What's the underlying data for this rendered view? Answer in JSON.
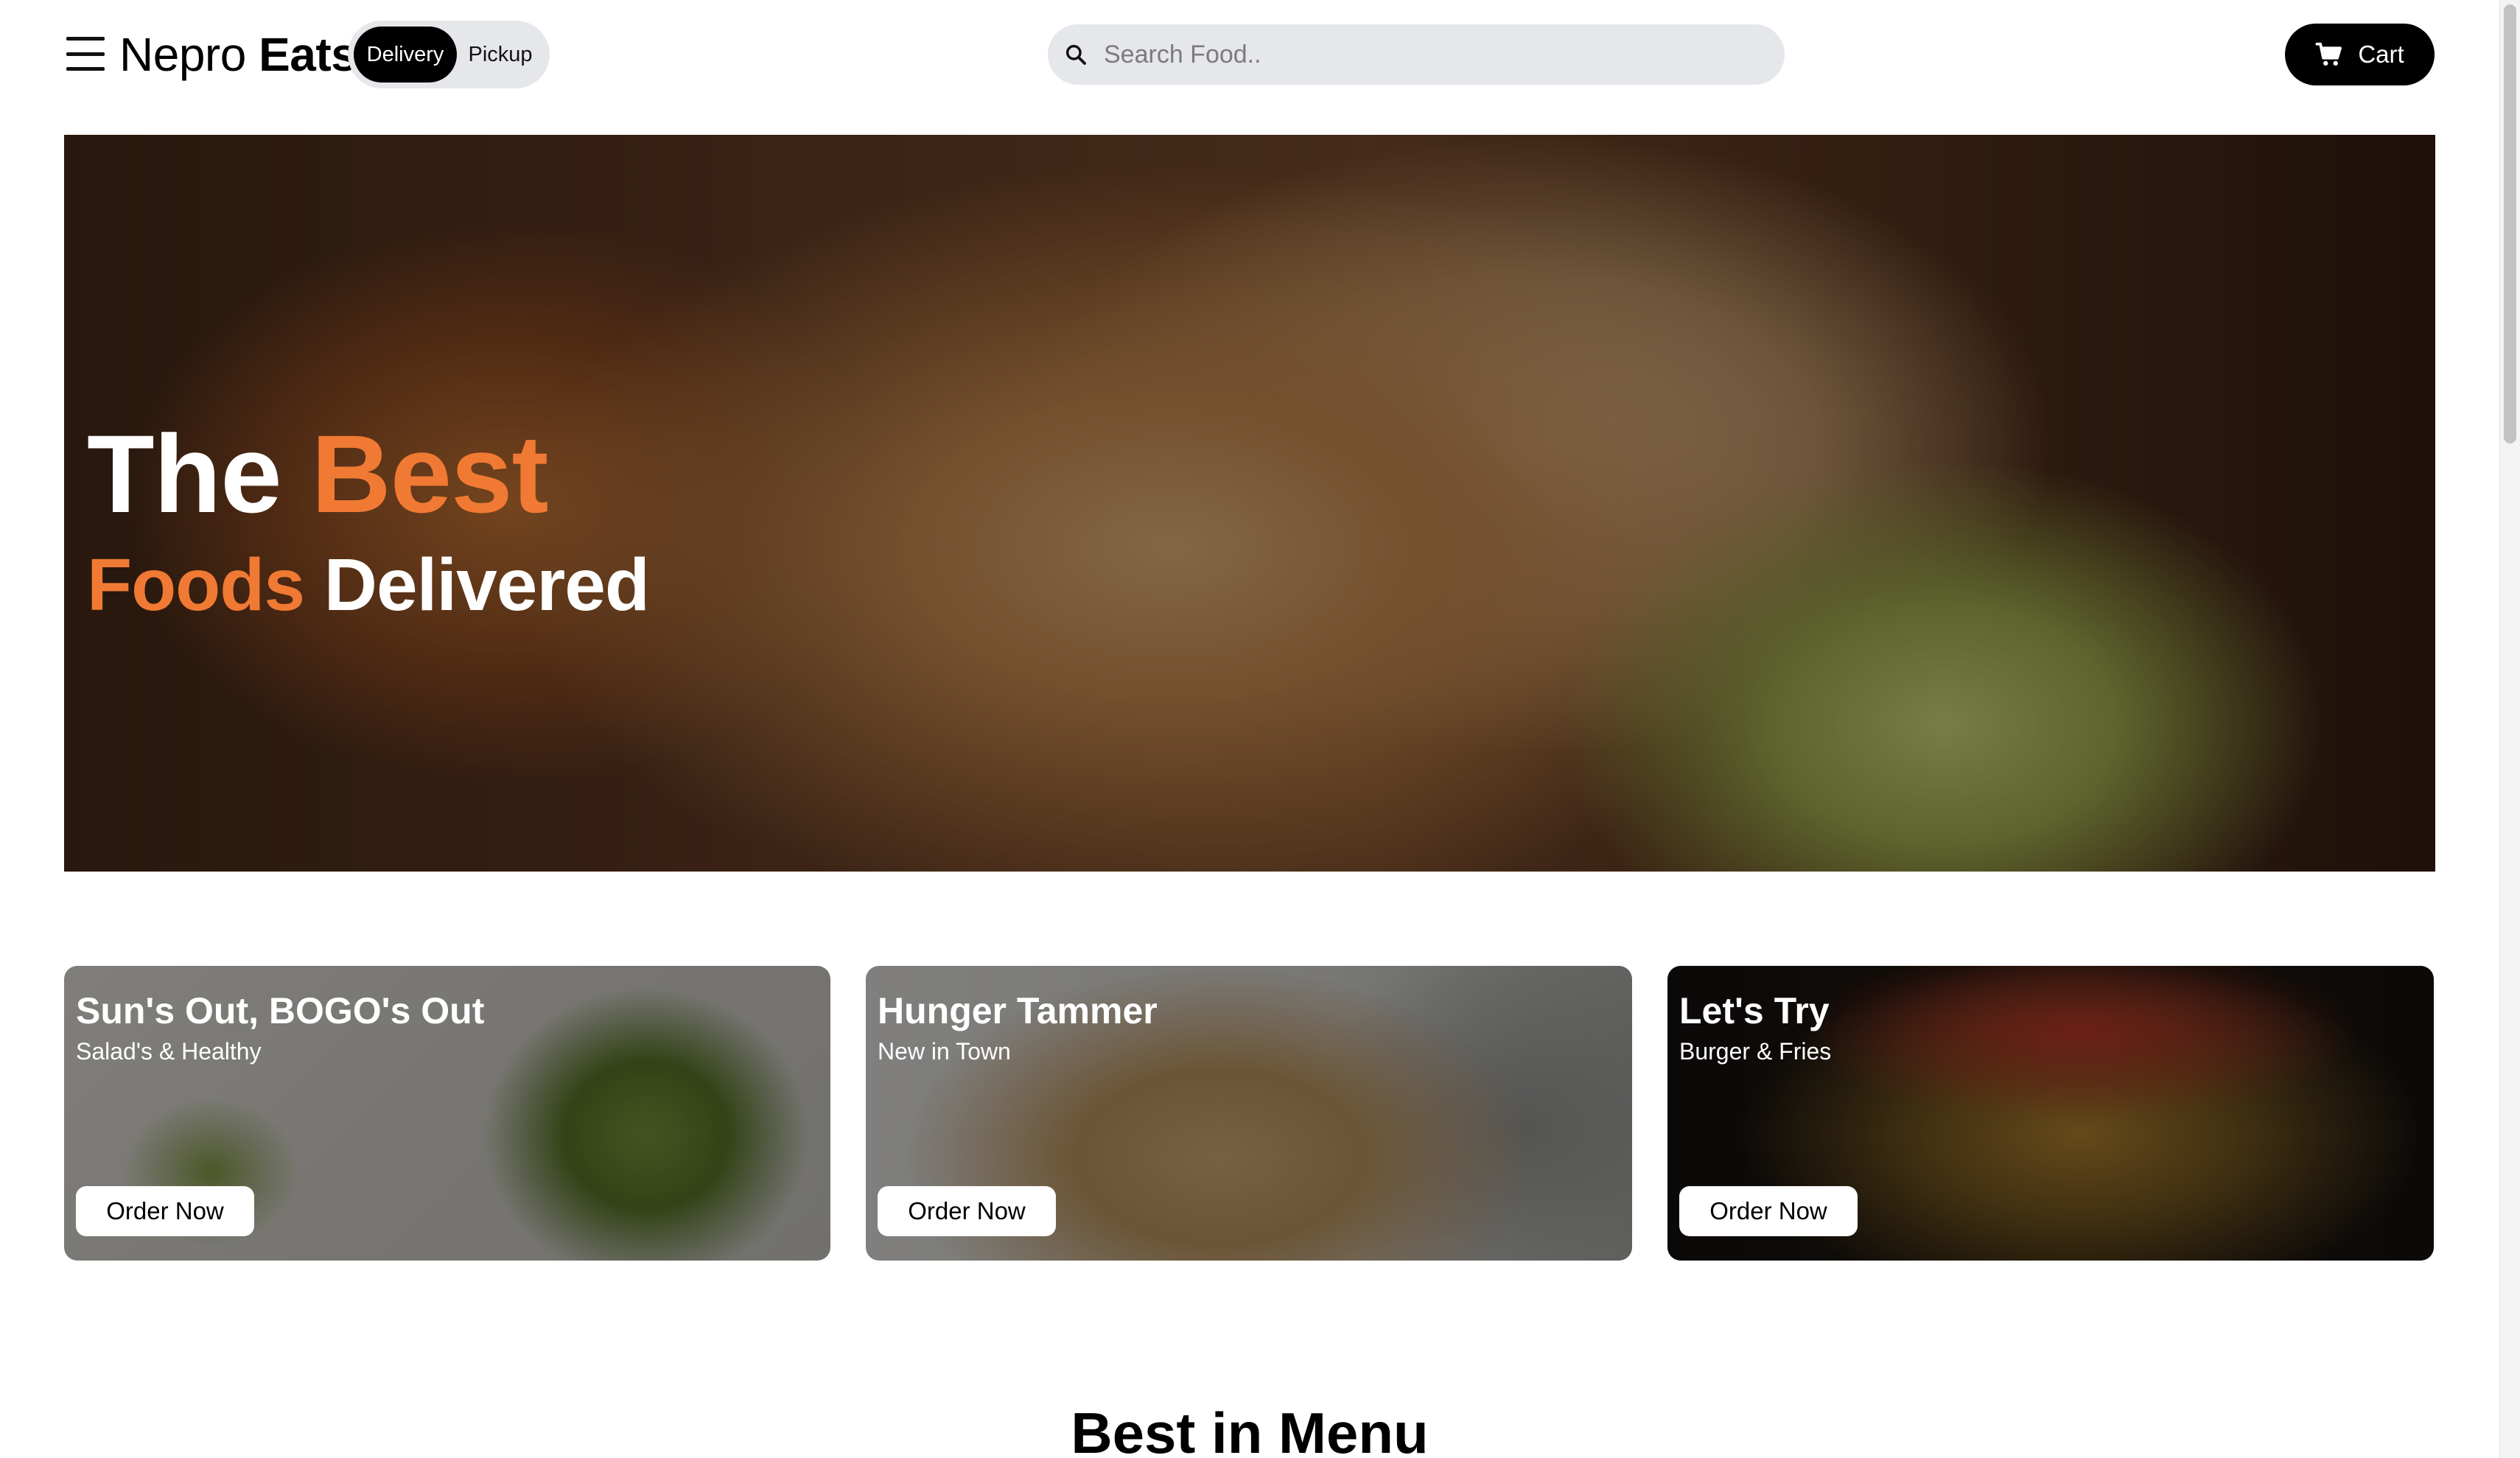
{
  "header": {
    "brand_part1": "Nepro",
    "brand_part2": "Eats",
    "toggle": {
      "delivery": "Delivery",
      "pickup": "Pickup",
      "selected": "Delivery"
    },
    "search": {
      "placeholder": "Search Food..",
      "value": ""
    },
    "cart_label": "Cart"
  },
  "hero": {
    "line1_word1": "The",
    "line1_word2": "Best",
    "line2_word1": "Foods",
    "line2_word2": "Delivered"
  },
  "promos": [
    {
      "title": "Sun's Out, BOGO's Out",
      "subtitle": "Salad's & Healthy",
      "button": "Order Now"
    },
    {
      "title": "Hunger Tammer",
      "subtitle": "New in Town",
      "button": "Order Now"
    },
    {
      "title": "Let's Try",
      "subtitle": "Burger & Fries",
      "button": "Order Now"
    }
  ],
  "section_title": "Best in Menu",
  "colors": {
    "accent": "#f07a33",
    "primary": "#000000",
    "pill_bg": "#e5e7eb"
  },
  "icons": {
    "menu": "hamburger-menu-icon",
    "search": "search-icon",
    "cart": "cart-icon"
  }
}
